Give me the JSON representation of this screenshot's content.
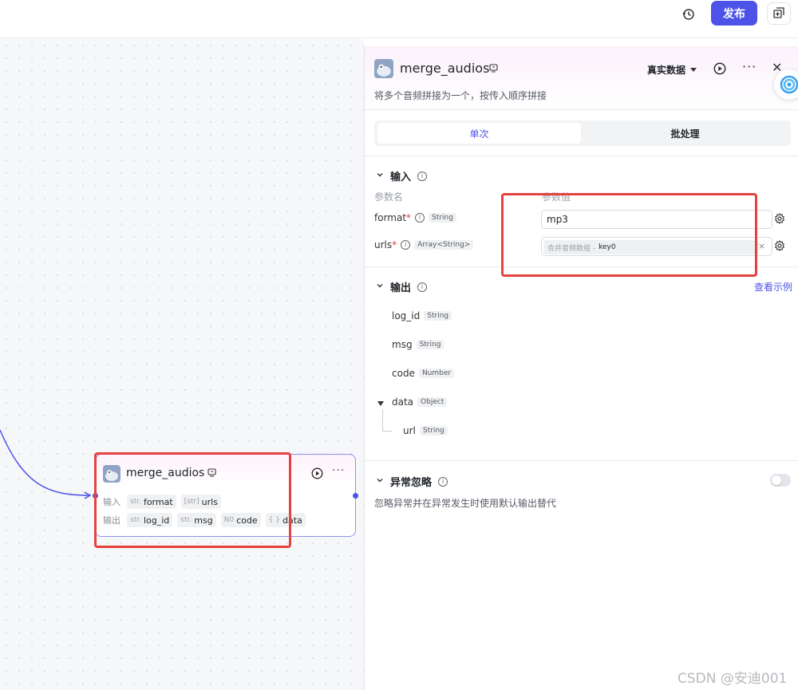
{
  "topbar": {
    "publish_label": "发布",
    "history_icon": "history-icon",
    "copy_icon": "copy-icon"
  },
  "node": {
    "title": "merge_audios",
    "input_label": "输入",
    "output_label": "输出",
    "inputs": [
      {
        "type": "str.",
        "name": "format"
      },
      {
        "type": "[str]",
        "name": "urls"
      }
    ],
    "outputs": [
      {
        "type": "str.",
        "name": "log_id"
      },
      {
        "type": "str.",
        "name": "msg"
      },
      {
        "type": "N0",
        "name": "code"
      },
      {
        "type": "{ }",
        "name": "data"
      }
    ]
  },
  "panel": {
    "title": "merge_audios",
    "data_mode": "真实数据",
    "description": "将多个音频拼接为一个，按传入顺序拼接",
    "tabs": [
      {
        "label": "单次",
        "active": true
      },
      {
        "label": "批处理",
        "active": false
      }
    ],
    "input_section": {
      "title": "输入",
      "col_name": "参数名",
      "col_value": "参数值",
      "params": [
        {
          "name": "format",
          "required": "*",
          "type": "String",
          "value": "mp3"
        },
        {
          "name": "urls",
          "required": "*",
          "type": "Array<String>",
          "ref_source": "合并音频数组 -",
          "ref_key": "key0"
        }
      ]
    },
    "output_section": {
      "title": "输出",
      "example_link": "查看示例",
      "fields": [
        {
          "name": "log_id",
          "type": "String"
        },
        {
          "name": "msg",
          "type": "String"
        },
        {
          "name": "code",
          "type": "Number"
        },
        {
          "name": "data",
          "type": "Object"
        },
        {
          "name": "url",
          "type": "String"
        }
      ]
    },
    "exception_section": {
      "title": "异常忽略",
      "enabled": false,
      "note": "忽略异常并在异常发生时使用默认输出替代"
    }
  },
  "watermark": "CSDN @安迪001",
  "colors": {
    "accent": "#4d53e8",
    "highlight_box": "#e5423f"
  }
}
